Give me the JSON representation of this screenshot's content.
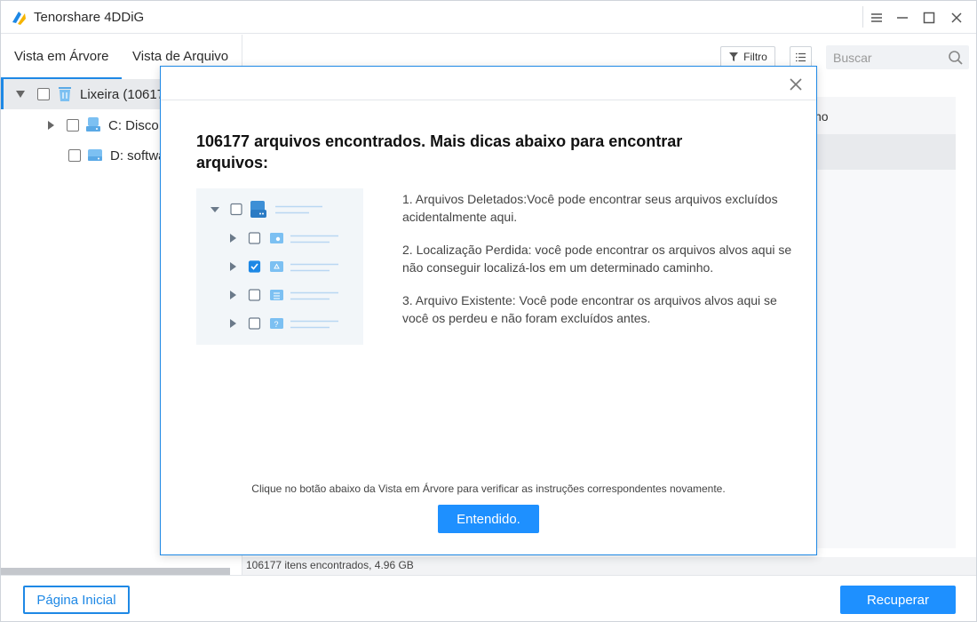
{
  "app": {
    "title": "Tenorshare 4DDiG"
  },
  "tabs": [
    {
      "label": "Vista em Árvore",
      "active": true
    },
    {
      "label": "Vista de Arquivo",
      "active": false
    }
  ],
  "toolbar": {
    "filter_label": "Filtro",
    "search_placeholder": "Buscar"
  },
  "tree": [
    {
      "label": "Lixeira (10617",
      "icon": "recycle-bin-icon",
      "expanded": true,
      "selected": true
    },
    {
      "label": "C: Disco",
      "icon": "drive-icon",
      "expanded": false
    },
    {
      "label": "D: softwa",
      "icon": "drive-icon",
      "expanded": false
    }
  ],
  "table": {
    "header_partial": "no"
  },
  "status": {
    "text": "106177 itens encontrados, 4.96 GB"
  },
  "bottom": {
    "home_label": "Página Inicial",
    "recover_label": "Recuperar"
  },
  "modal": {
    "title": "106177 arquivos encontrados. Mais dicas abaixo para encontrar arquivos:",
    "tips": [
      "1. Arquivos Deletados:Você pode encontrar seus arquivos excluídos acidentalmente aqui.",
      "2. Localização Perdida: você pode encontrar os arquivos alvos aqui se não conseguir localizá-los em um determinado caminho.",
      "3. Arquivo Existente: Você pode encontrar os arquivos alvos aqui se você os perdeu e não foram excluídos antes."
    ],
    "note": "Clique no botão abaixo da Vista em Árvore para verificar as instruções correspondentes novamente.",
    "ok_label": "Entendido."
  },
  "colors": {
    "accent": "#1e90ff",
    "selected_row": "#e8eaed"
  }
}
